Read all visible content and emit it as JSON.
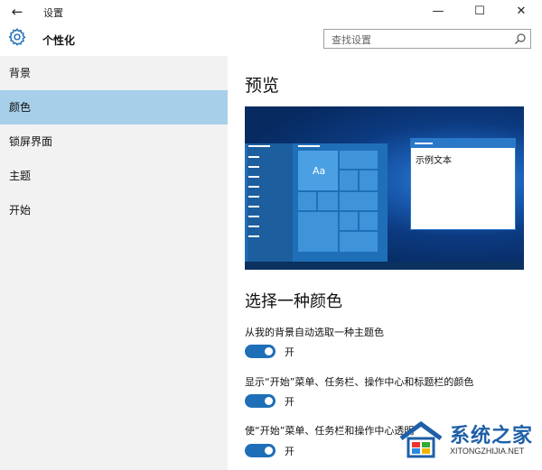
{
  "titlebar": {
    "back_icon": "←",
    "title": "设置",
    "min": "—",
    "max": "☐",
    "close": "✕"
  },
  "header": {
    "title": "个性化",
    "search_placeholder": "查找设置"
  },
  "sidebar": {
    "items": [
      {
        "label": "背景"
      },
      {
        "label": "颜色"
      },
      {
        "label": "锁屏界面"
      },
      {
        "label": "主题"
      },
      {
        "label": "开始"
      }
    ]
  },
  "main": {
    "preview_heading": "预览",
    "preview": {
      "tile_label": "Aa",
      "sample_text": "示例文本"
    },
    "color_heading": "选择一种颜色",
    "options": [
      {
        "label": "从我的背景自动选取一种主题色",
        "state": "开",
        "on": true
      },
      {
        "label": "显示“开始”菜单、任务栏、操作中心和标题栏的颜色",
        "state": "开",
        "on": true
      },
      {
        "label": "使“开始”菜单、任务栏和操作中心透明",
        "state": "开",
        "on": true
      }
    ]
  },
  "watermark": {
    "text": "系统之家",
    "sub": "XITONGZHIJIA.NET"
  },
  "colors": {
    "accent": "#1e6fb8",
    "sidebar_selected": "#a7cfe9",
    "sidebar_bg": "#f2f2f2"
  }
}
